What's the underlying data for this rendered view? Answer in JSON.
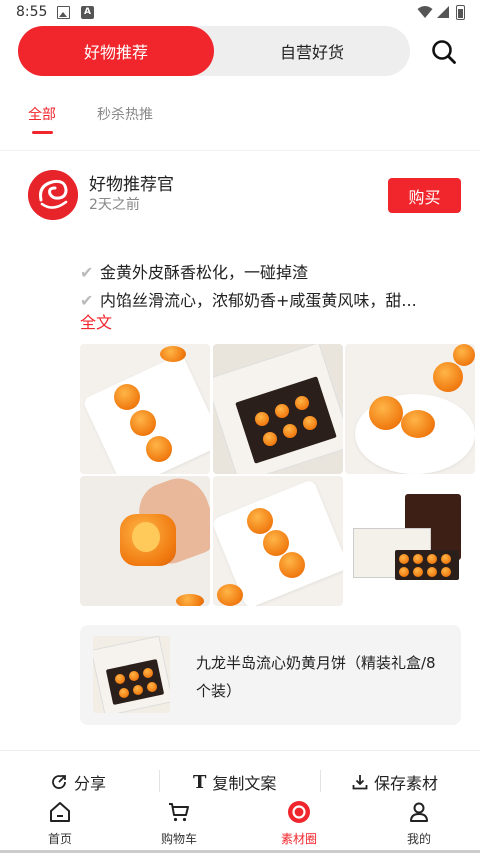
{
  "status_bar": {
    "time": "8:55",
    "notification_icons": [
      "image-icon",
      "a-icon"
    ],
    "system_icons": [
      "wifi-icon",
      "signal-icon",
      "battery-icon"
    ]
  },
  "top_tabs": {
    "active": "好物推荐",
    "inactive": "自营好货",
    "accent_color": "#f0262c"
  },
  "sub_tabs": [
    {
      "label": "全部",
      "selected": true
    },
    {
      "label": "秒杀热推",
      "selected": false
    }
  ],
  "post": {
    "author": "好物推荐官",
    "time": "2天之前",
    "buy_label": "购买",
    "lines": [
      "金黄外皮酥香松化，一碰掉渣",
      "内馅丝滑流心，浓郁奶香+咸蛋黄风味，甜..."
    ],
    "full_text_label": "全文",
    "product": {
      "title": "九龙半岛流心奶黄月饼（精装礼盒/8个装）"
    }
  },
  "actions": {
    "share": "分享",
    "copy": "复制文案",
    "save": "保存素材"
  },
  "bottom_nav": [
    {
      "label": "首页",
      "icon": "home-icon",
      "active": false
    },
    {
      "label": "购物车",
      "icon": "cart-icon",
      "active": false
    },
    {
      "label": "素材圈",
      "icon": "material-circle-icon",
      "active": true
    },
    {
      "label": "我的",
      "icon": "user-icon",
      "active": false
    }
  ]
}
